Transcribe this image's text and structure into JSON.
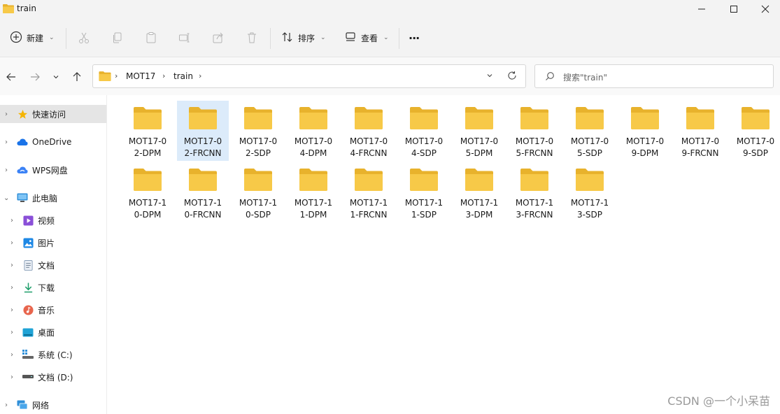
{
  "window": {
    "title": "train"
  },
  "toolbar": {
    "new_label": "新建",
    "sort_label": "排序",
    "view_label": "查看",
    "more_label": "···"
  },
  "address": {
    "crumbs": [
      "MOT17",
      "train"
    ]
  },
  "search": {
    "placeholder": "搜索\"train\""
  },
  "sidebar": {
    "items": [
      {
        "label": "快速访问",
        "icon": "star-icon",
        "selected": true
      },
      {
        "label": "OneDrive",
        "icon": "cloud-icon"
      },
      {
        "label": "WPS网盘",
        "icon": "wps-cloud-icon"
      },
      {
        "label": "此电脑",
        "icon": "computer-icon",
        "expanded": true
      },
      {
        "label": "视频",
        "icon": "video-icon"
      },
      {
        "label": "图片",
        "icon": "picture-icon"
      },
      {
        "label": "文档",
        "icon": "document-icon"
      },
      {
        "label": "下载",
        "icon": "download-icon"
      },
      {
        "label": "音乐",
        "icon": "music-icon"
      },
      {
        "label": "桌面",
        "icon": "desktop-icon"
      },
      {
        "label": "系统 (C:)",
        "icon": "drive-c-icon"
      },
      {
        "label": "文档 (D:)",
        "icon": "drive-d-icon"
      },
      {
        "label": "网络",
        "icon": "network-icon"
      }
    ]
  },
  "folders": [
    {
      "line1": "MOT17-0",
      "line2": "2-DPM"
    },
    {
      "line1": "MOT17-0",
      "line2": "2-FRCNN",
      "selected": true
    },
    {
      "line1": "MOT17-0",
      "line2": "2-SDP"
    },
    {
      "line1": "MOT17-0",
      "line2": "4-DPM"
    },
    {
      "line1": "MOT17-0",
      "line2": "4-FRCNN"
    },
    {
      "line1": "MOT17-0",
      "line2": "4-SDP"
    },
    {
      "line1": "MOT17-0",
      "line2": "5-DPM"
    },
    {
      "line1": "MOT17-0",
      "line2": "5-FRCNN"
    },
    {
      "line1": "MOT17-0",
      "line2": "5-SDP"
    },
    {
      "line1": "MOT17-0",
      "line2": "9-DPM"
    },
    {
      "line1": "MOT17-0",
      "line2": "9-FRCNN"
    },
    {
      "line1": "MOT17-0",
      "line2": "9-SDP"
    },
    {
      "line1": "MOT17-1",
      "line2": "0-DPM"
    },
    {
      "line1": "MOT17-1",
      "line2": "0-FRCNN"
    },
    {
      "line1": "MOT17-1",
      "line2": "0-SDP"
    },
    {
      "line1": "MOT17-1",
      "line2": "1-DPM"
    },
    {
      "line1": "MOT17-1",
      "line2": "1-FRCNN"
    },
    {
      "line1": "MOT17-1",
      "line2": "1-SDP"
    },
    {
      "line1": "MOT17-1",
      "line2": "3-DPM"
    },
    {
      "line1": "MOT17-1",
      "line2": "3-FRCNN"
    },
    {
      "line1": "MOT17-1",
      "line2": "3-SDP"
    }
  ],
  "watermark": "CSDN @一个小呆苗",
  "colors": {
    "folder": "#f7c948",
    "folder_dark": "#e8b22c",
    "selection": "#dcebfa",
    "nav_selected": "#e5e5e5"
  }
}
